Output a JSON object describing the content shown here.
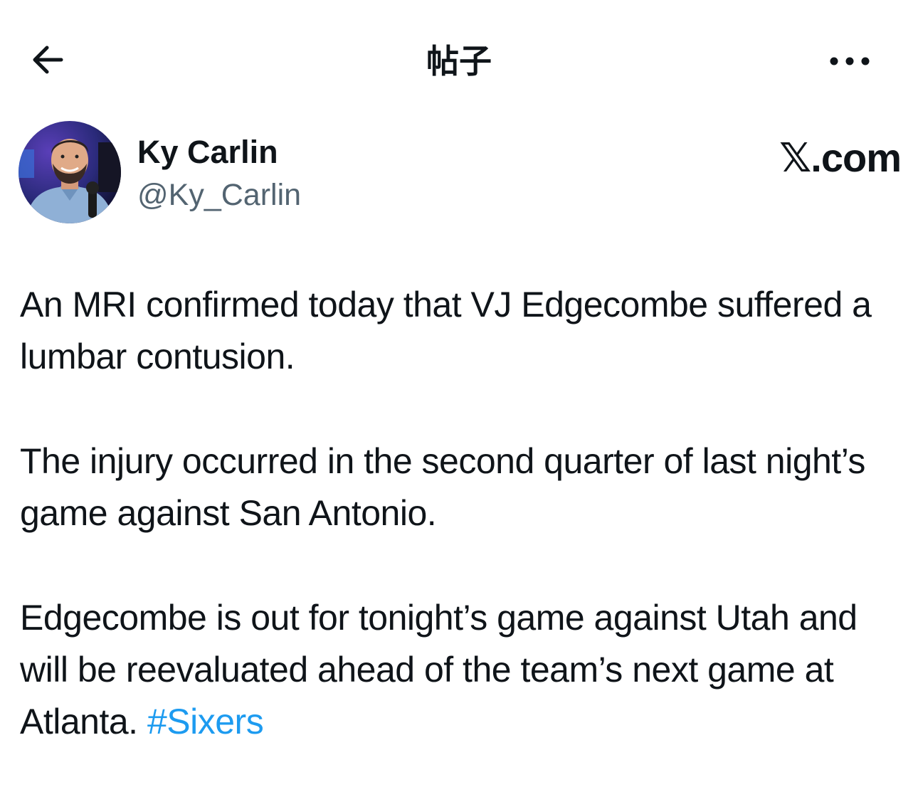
{
  "header": {
    "title": "帖子",
    "back_icon": "arrow-left-icon",
    "more_icon": "more-horizontal-icon"
  },
  "author": {
    "display_name": "Ky Carlin",
    "handle": "@Ky_Carlin",
    "avatar_icon": "avatar-photo"
  },
  "source_label": "𝕏.com",
  "tweet": {
    "paragraph_1": "An MRI confirmed today that VJ Edgecombe suffered a lumbar contusion.",
    "paragraph_2": "The injury occurred in the second quarter of last night’s game against San Antonio.",
    "paragraph_3_text": "Edgecombe is out for tonight’s game against Utah and will be reevaluated ahead of the team’s next game at Atlanta.",
    "hashtag": "#Sixers"
  },
  "colors": {
    "text": "#0f1419",
    "secondary_text": "#536471",
    "link": "#1d9bf0",
    "background": "#ffffff"
  }
}
